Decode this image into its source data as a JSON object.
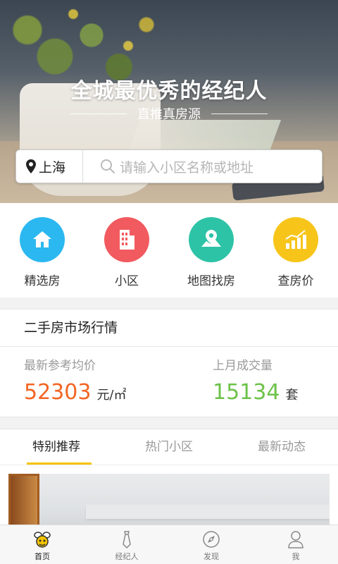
{
  "hero": {
    "title": "全城最优秀的经纪人",
    "subtitle": "直推真房源"
  },
  "search": {
    "city": "上海",
    "placeholder": "请输入小区名称或地址"
  },
  "quick_nav": [
    {
      "label": "精选房",
      "icon": "house-icon",
      "color": "#2bb8f0"
    },
    {
      "label": "小区",
      "icon": "building-icon",
      "color": "#f15a5f"
    },
    {
      "label": "地图找房",
      "icon": "map-pin-icon",
      "color": "#2dc3a6"
    },
    {
      "label": "查房价",
      "icon": "bar-chart-icon",
      "color": "#f7c51a"
    }
  ],
  "market": {
    "title": "二手房市场行情",
    "avg_price_label": "最新参考均价",
    "avg_price_value": "52303",
    "avg_price_unit": "元/㎡",
    "volume_label": "上月成交量",
    "volume_value": "15134",
    "volume_unit": "套"
  },
  "tabs": [
    {
      "label": "特别推荐",
      "active": true
    },
    {
      "label": "热门小区",
      "active": false
    },
    {
      "label": "最新动态",
      "active": false
    }
  ],
  "bottom_nav": [
    {
      "label": "首页",
      "icon": "bee-home-icon",
      "active": true
    },
    {
      "label": "经纪人",
      "icon": "tie-icon",
      "active": false
    },
    {
      "label": "发现",
      "icon": "compass-icon",
      "active": false
    },
    {
      "label": "我",
      "icon": "user-icon",
      "active": false
    }
  ],
  "colors": {
    "accent": "#f5c400",
    "price": "#f26522",
    "volume": "#6cc24a"
  }
}
